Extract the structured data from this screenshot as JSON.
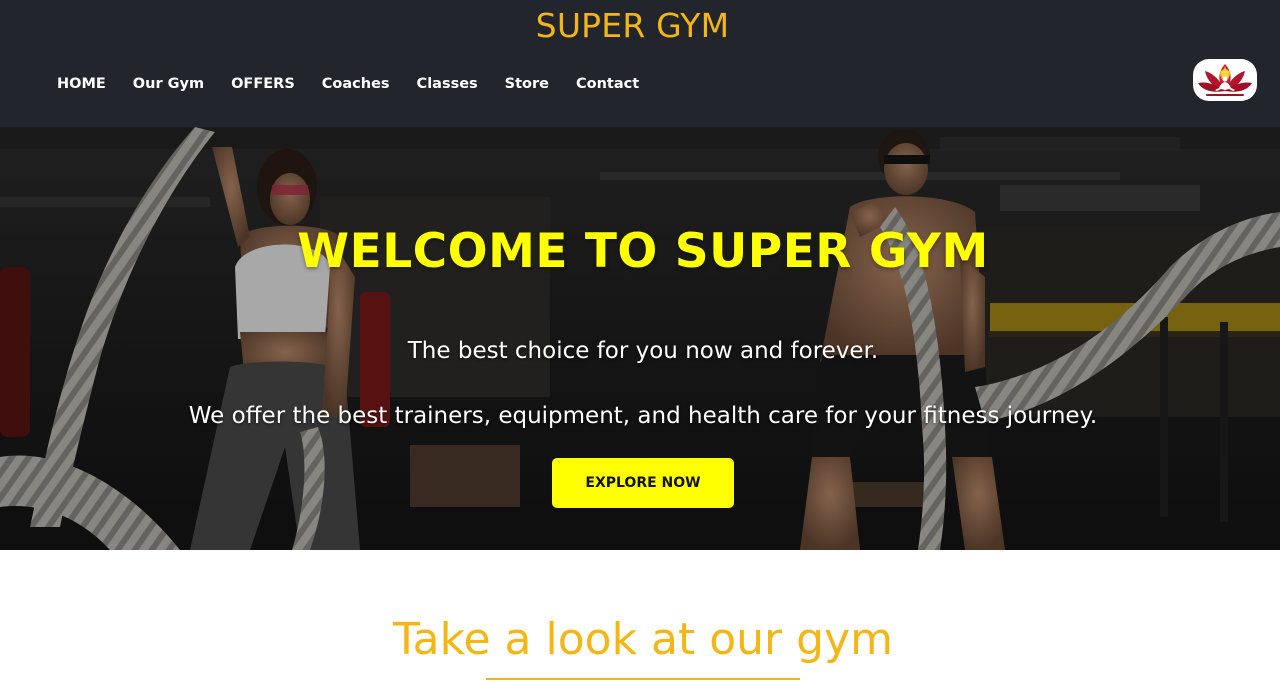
{
  "header": {
    "brand": "SUPER GYM",
    "nav": [
      "HOME",
      "Our Gym",
      "OFFERS",
      "Coaches",
      "Classes",
      "Store",
      "Contact"
    ],
    "logo_icon": "lotus-meditation-logo"
  },
  "hero": {
    "title": "WELCOME TO SUPER GYM",
    "subtitle": "The best choice for you now and forever.",
    "description": "We offer the best trainers, equipment, and health care for your fitness journey.",
    "button_label": "EXPLORE NOW"
  },
  "gym_section": {
    "title": "Take a look at our gym"
  },
  "colors": {
    "header_bg": "#22252b",
    "brand": "#f3b614",
    "hero_title": "#ffff00",
    "button_bg": "#ffff00",
    "section_title": "#f3b614"
  }
}
